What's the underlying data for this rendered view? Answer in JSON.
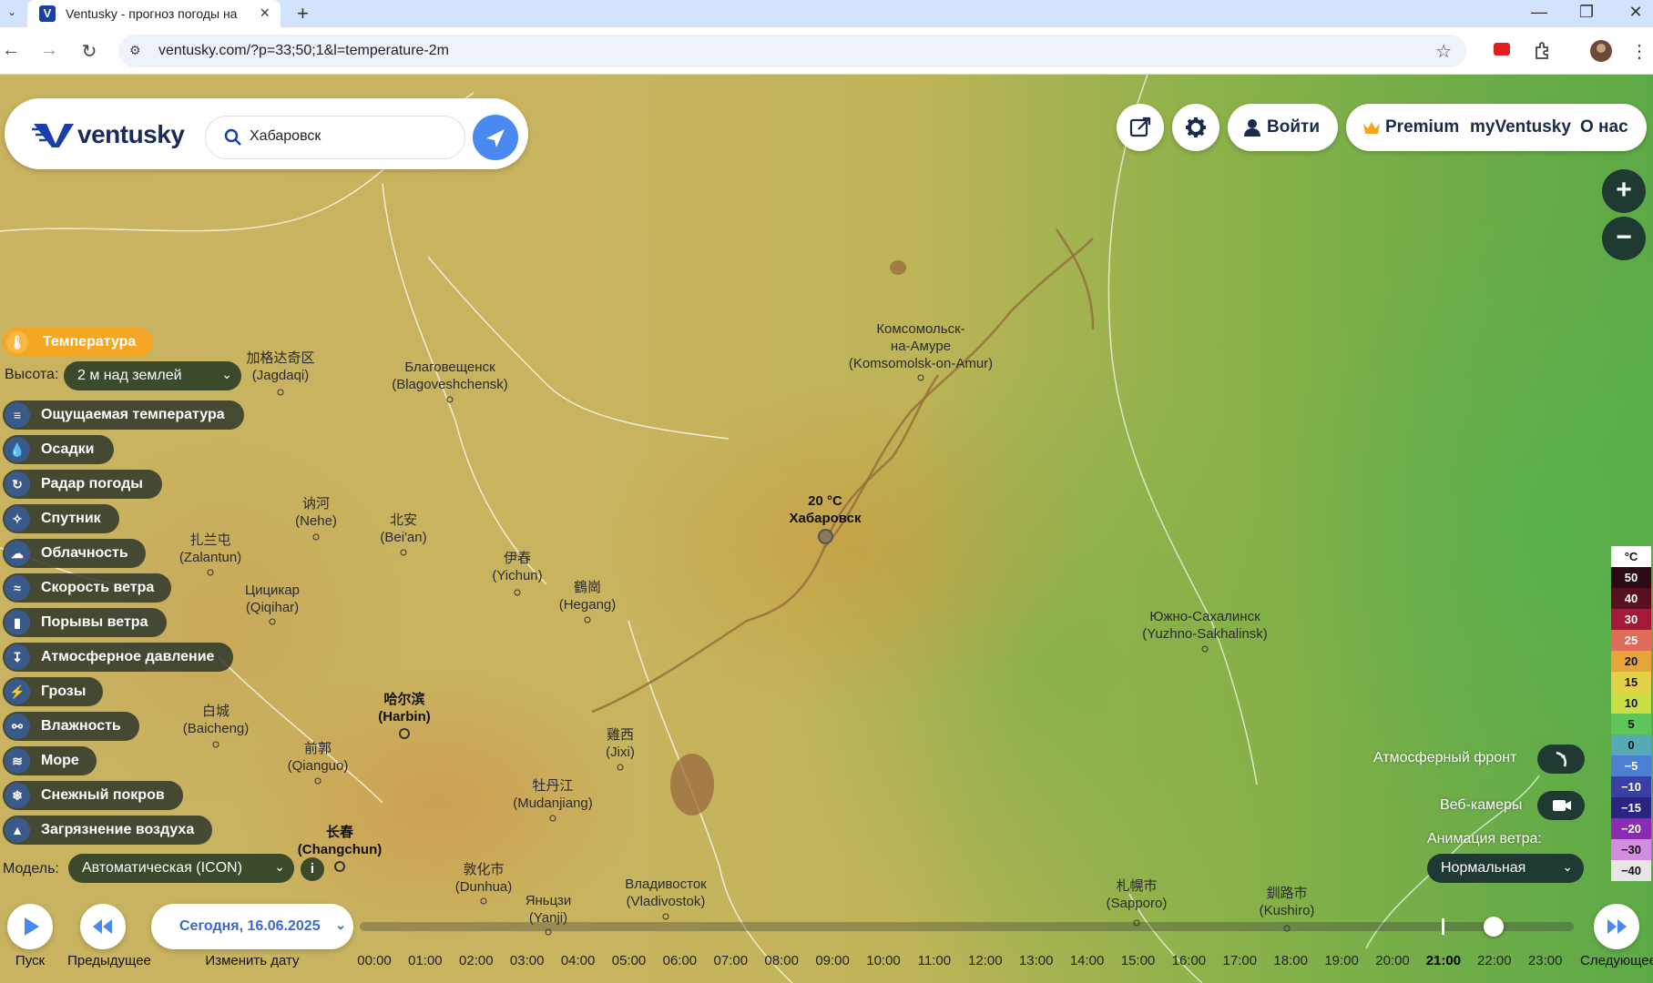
{
  "browser": {
    "tab_title": "Ventusky - прогноз погоды на",
    "url": "ventusky.com/?p=33;50;1&l=temperature-2m"
  },
  "header": {
    "logo_text": "ventusky",
    "search_value": "Хабаровск",
    "login_label": "Войти",
    "menu": {
      "premium": "Premium",
      "myventusky": "myVentusky",
      "about": "О нас"
    }
  },
  "layers": {
    "active": "Температура",
    "height_label": "Высота:",
    "height_value": "2 м над землей",
    "items": [
      {
        "label": "Ощущаемая температура",
        "icon": "feels-like-icon"
      },
      {
        "label": "Осадки",
        "icon": "drop-icon"
      },
      {
        "label": "Радар погоды",
        "icon": "radar-icon"
      },
      {
        "label": "Спутник",
        "icon": "satellite-icon"
      },
      {
        "label": "Облачность",
        "icon": "cloud-icon"
      },
      {
        "label": "Скорость ветра",
        "icon": "wind-icon"
      },
      {
        "label": "Порывы ветра",
        "icon": "gust-icon"
      },
      {
        "label": "Атмосферное давление",
        "icon": "pressure-icon"
      },
      {
        "label": "Грозы",
        "icon": "lightning-icon"
      },
      {
        "label": "Влажность",
        "icon": "humidity-icon"
      },
      {
        "label": "Море",
        "icon": "waves-icon"
      },
      {
        "label": "Снежный покров",
        "icon": "snowflake-icon"
      },
      {
        "label": "Загрязнение воздуха",
        "icon": "factory-icon"
      }
    ],
    "model_label": "Модель:",
    "model_value": "Автоматическая (ICON)"
  },
  "map": {
    "selected": {
      "temp": "20 °C",
      "name": "Хабаровск"
    },
    "cities": [
      {
        "name": "加格达奇区",
        "sub": "(Jagdaqi)"
      },
      {
        "name": "Благовещенск",
        "sub": "(Blagoveshchensk)"
      },
      {
        "name": "Комсомольск-",
        "sub": "на-Амуре",
        "sub2": "(Komsomolsk-on-Amur)"
      },
      {
        "name": "讷河",
        "sub": "(Nehe)"
      },
      {
        "name": "北安",
        "sub": "(Bei'an)"
      },
      {
        "name": "扎兰屯",
        "sub": "(Zalantun)"
      },
      {
        "name": "伊春",
        "sub": "(Yichun)"
      },
      {
        "name": "鶴崗",
        "sub": "(Hegang)"
      },
      {
        "name": "Цицикар",
        "sub": "(Qiqihar)"
      },
      {
        "name": "Южно-Сахалинск",
        "sub": "(Yuzhno-Sakhalinsk)"
      },
      {
        "name": "哈尔滨",
        "sub": "(Harbin)"
      },
      {
        "name": "白城",
        "sub": "(Baicheng)"
      },
      {
        "name": "前郭",
        "sub": "(Qianguo)"
      },
      {
        "name": "雞西",
        "sub": "(Jixi)"
      },
      {
        "name": "牡丹江",
        "sub": "(Mudanjiang)"
      },
      {
        "name": "长春",
        "sub": "(Changchun)"
      },
      {
        "name": "敦化市",
        "sub": "(Dunhua)"
      },
      {
        "name": "Владивосток",
        "sub": "(Vladivostok)"
      },
      {
        "name": "Яньцзи",
        "sub": "(Yanji)"
      },
      {
        "name": "札幌市",
        "sub": "(Sapporo)"
      },
      {
        "name": "釧路市",
        "sub": "(Kushiro)"
      }
    ]
  },
  "legend": {
    "unit": "°C",
    "steps": [
      {
        "label": "50",
        "color": "#2b0a14",
        "text": "#fff"
      },
      {
        "label": "40",
        "color": "#5a0f1e",
        "text": "#fff"
      },
      {
        "label": "30",
        "color": "#a4183a",
        "text": "#fff"
      },
      {
        "label": "25",
        "color": "#e06d5a",
        "text": "#fff"
      },
      {
        "label": "20",
        "color": "#e8a43a",
        "text": "#111"
      },
      {
        "label": "15",
        "color": "#e3d148",
        "text": "#111"
      },
      {
        "label": "10",
        "color": "#c9df44",
        "text": "#111"
      },
      {
        "label": "5",
        "color": "#5fc45a",
        "text": "#111"
      },
      {
        "label": "0",
        "color": "#56aab5",
        "text": "#111"
      },
      {
        "label": "−5",
        "color": "#4a7fd1",
        "text": "#fff"
      },
      {
        "label": "−10",
        "color": "#3a3fa8",
        "text": "#fff"
      },
      {
        "label": "−15",
        "color": "#2a2480",
        "text": "#fff"
      },
      {
        "label": "−20",
        "color": "#8c2ab5",
        "text": "#fff"
      },
      {
        "label": "−30",
        "color": "#d38de0",
        "text": "#111"
      },
      {
        "label": "−40",
        "color": "#e6e6e6",
        "text": "#111"
      }
    ]
  },
  "right_panel": {
    "front_label": "Атмосферный фронт",
    "webcam_label": "Веб-камеры",
    "wind_anim_label": "Анимация ветра:",
    "wind_anim_value": "Нормальная"
  },
  "timeline": {
    "play_label": "Пуск",
    "prev_label": "Предыдущее",
    "date_value": "Сегодня, 16.06.2025",
    "change_date_label": "Изменить дату",
    "next_label": "Следующее",
    "hours": [
      "00:00",
      "01:00",
      "02:00",
      "03:00",
      "04:00",
      "05:00",
      "06:00",
      "07:00",
      "08:00",
      "09:00",
      "10:00",
      "11:00",
      "12:00",
      "13:00",
      "14:00",
      "15:00",
      "16:00",
      "17:00",
      "18:00",
      "19:00",
      "20:00",
      "21:00",
      "22:00",
      "23:00"
    ],
    "current_hour": "21:00"
  },
  "colors": {
    "accent": "#4a8af0",
    "active_layer": "#f5a623",
    "dark_button": "#1e3a33"
  }
}
